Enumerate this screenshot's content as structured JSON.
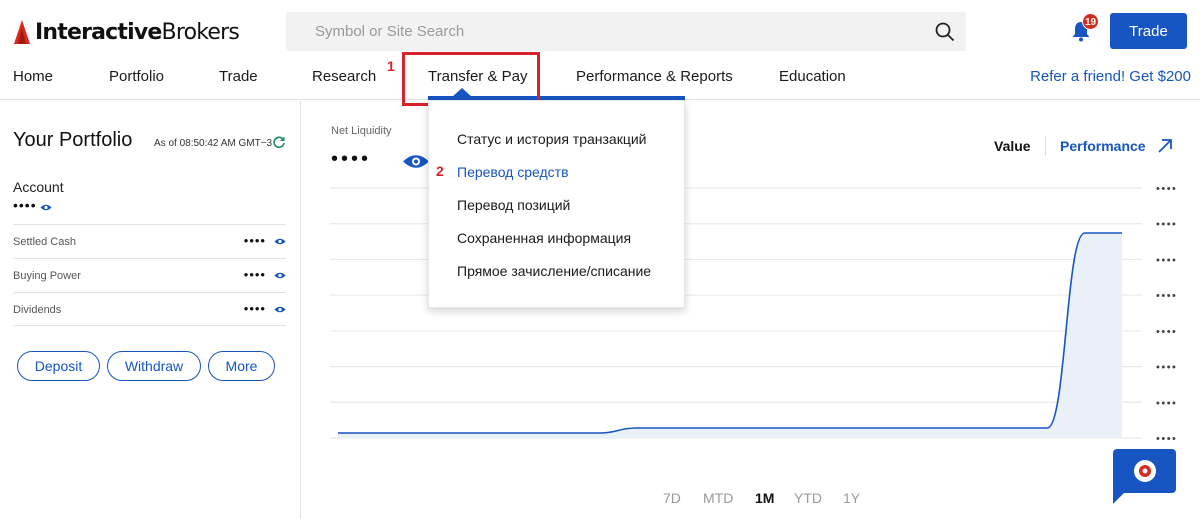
{
  "header": {
    "logo_bold": "Interactive",
    "logo_regular": "Brokers",
    "search_placeholder": "Symbol or Site Search",
    "notification_count": "19",
    "trade_button": "Trade"
  },
  "nav": {
    "items": [
      "Home",
      "Portfolio",
      "Trade",
      "Research",
      "Transfer & Pay",
      "Performance & Reports",
      "Education"
    ],
    "refer": "Refer a friend! Get $200",
    "active_item": "Transfer & Pay"
  },
  "annotations": {
    "step1": "1",
    "step2": "2"
  },
  "dropdown": {
    "items": [
      "Статус и история транзакций",
      "Перевод средств",
      "Перевод позиций",
      "Сохраненная информация",
      "Прямое зачисление/списание"
    ],
    "active_index": 1
  },
  "portfolio": {
    "title": "Your Portfolio",
    "as_of": "As of 08:50:42 AM GMT−3",
    "account_label": "Account",
    "account_value": "••••",
    "rows": [
      {
        "label": "Settled Cash",
        "value": "••••"
      },
      {
        "label": "Buying Power",
        "value": "••••"
      },
      {
        "label": "Dividends",
        "value": "••••"
      }
    ],
    "buttons": [
      "Deposit",
      "Withdraw",
      "More"
    ]
  },
  "main": {
    "net_liquidity_label": "Net Liquidity",
    "net_liquidity_value": "••••",
    "tab_value": "Value",
    "tab_performance": "Performance",
    "axis_labels": [
      "••••",
      "••••",
      "••••",
      "••••",
      "••••",
      "••••",
      "••••",
      "••••"
    ],
    "ranges": [
      "7D",
      "MTD",
      "1M",
      "YTD",
      "1Y"
    ],
    "active_range": "1M"
  },
  "colors": {
    "brand_blue": "#1655c2",
    "brand_red": "#d52b1e",
    "annotation_red": "#d8232a"
  },
  "chart_data": {
    "type": "area",
    "series": [
      {
        "values": [
          0.02,
          0.02,
          0.02,
          0.02,
          0.02,
          0.02,
          0.02,
          0.02,
          0.04,
          0.04,
          0.04,
          0.04,
          0.04,
          0.04,
          0.04,
          0.04,
          0.04,
          0.04,
          0.04,
          0.04,
          0.82,
          0.82
        ]
      }
    ],
    "grid": true
  }
}
